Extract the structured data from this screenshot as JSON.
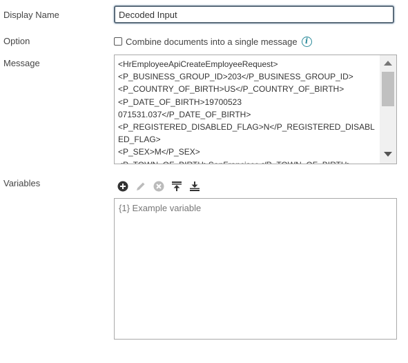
{
  "fields": {
    "display_name": {
      "label": "Display Name",
      "value": "Decoded Input"
    },
    "option": {
      "label": "Option",
      "checkbox_label": "Combine documents into a single message",
      "checked": false
    },
    "message": {
      "label": "Message",
      "content": "<HrEmployeeApiCreateEmployeeRequest>\n<P_BUSINESS_GROUP_ID>203</P_BUSINESS_GROUP_ID>\n<P_COUNTRY_OF_BIRTH>US</P_COUNTRY_OF_BIRTH>\n<P_DATE_OF_BIRTH>19700523\n071531.037</P_DATE_OF_BIRTH>\n<P_REGISTERED_DISABLED_FLAG>N</P_REGISTERED_DISABLED_FLAG>\n<P_SEX>M</P_SEX>\n<P_TOWN_OF_BIRTH>SanFrancisco</P_TOWN_OF_BIRTH>"
    },
    "variables": {
      "label": "Variables",
      "placeholder": "{1} Example variable"
    }
  },
  "toolbar": [
    {
      "name": "add-icon",
      "enabled": true
    },
    {
      "name": "edit-icon",
      "enabled": false
    },
    {
      "name": "remove-icon",
      "enabled": false
    },
    {
      "name": "move-to-top-icon",
      "enabled": true
    },
    {
      "name": "move-to-bottom-icon",
      "enabled": true
    }
  ],
  "colors": {
    "focus_border": "#5a6b7a",
    "info_icon": "#2a8a9a",
    "icon_dark": "#333333",
    "icon_disabled": "#bbbbbb"
  }
}
